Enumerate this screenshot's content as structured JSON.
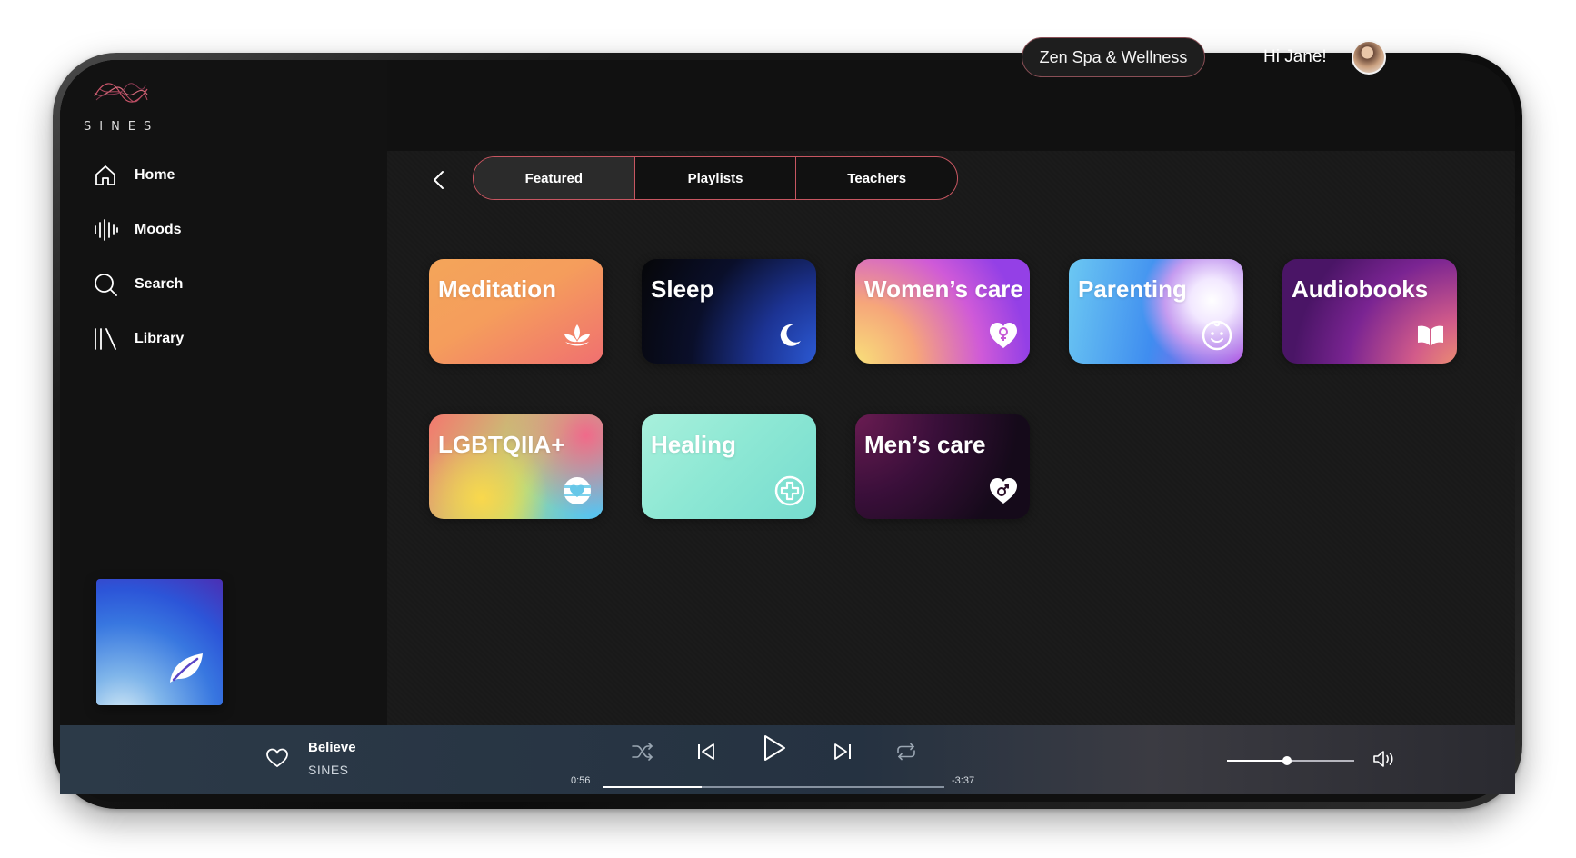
{
  "app": {
    "logo_text": "SINES"
  },
  "header": {
    "organization": "Zen Spa & Wellness",
    "greeting": "Hi Jane!"
  },
  "sidebar": {
    "items": [
      {
        "label": "Home",
        "icon": "home-icon"
      },
      {
        "label": "Moods",
        "icon": "soundwave-icon"
      },
      {
        "label": "Search",
        "icon": "search-icon"
      },
      {
        "label": "Library",
        "icon": "library-icon"
      }
    ]
  },
  "tabs": [
    {
      "label": "Featured",
      "active": true
    },
    {
      "label": "Playlists",
      "active": false
    },
    {
      "label": "Teachers",
      "active": false
    }
  ],
  "categories": [
    {
      "label": "Meditation",
      "icon": "lotus-icon"
    },
    {
      "label": "Sleep",
      "icon": "moon-icon"
    },
    {
      "label": "Women’s care",
      "icon": "female-heart-icon"
    },
    {
      "label": "Parenting",
      "icon": "baby-face-icon"
    },
    {
      "label": "Audiobooks",
      "icon": "open-book-icon"
    },
    {
      "label": "LGBTQIIA+",
      "icon": "rainbow-heart-icon"
    },
    {
      "label": "Healing",
      "icon": "plus-circle-icon"
    },
    {
      "label": "Men’s care",
      "icon": "male-heart-icon"
    }
  ],
  "player": {
    "track_title": "Believe",
    "track_artist": "SINES",
    "elapsed": "0:56",
    "remaining": "-3:37",
    "progress_fraction": 0.29,
    "volume_fraction": 0.47
  }
}
